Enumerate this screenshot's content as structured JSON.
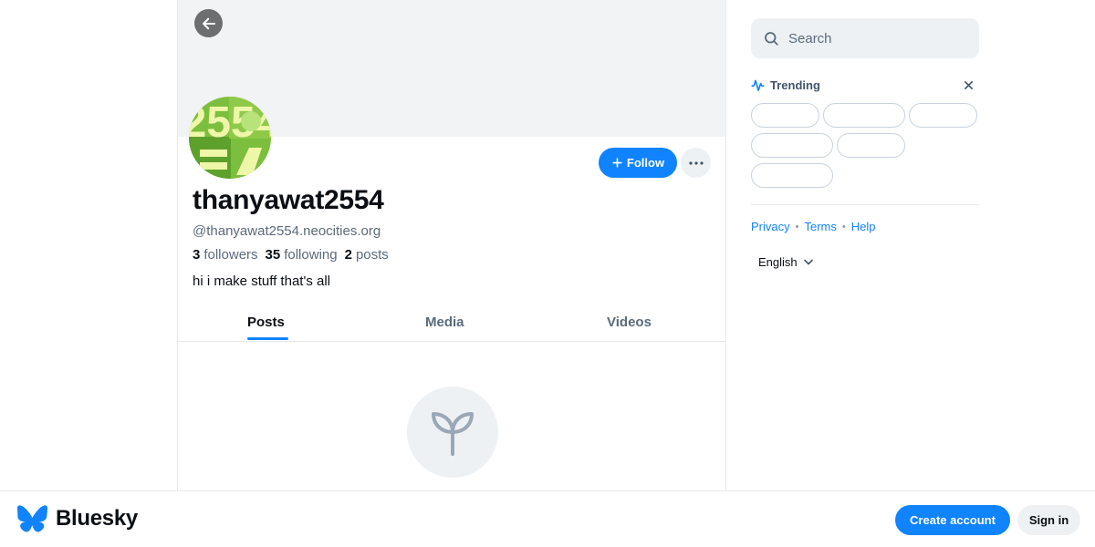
{
  "profile": {
    "display_name": "thanyawat2554",
    "handle": "@thanyawat2554.neocities.org",
    "followers_count": "3",
    "followers_label": "followers",
    "following_count": "35",
    "following_label": "following",
    "posts_count": "2",
    "posts_label": "posts",
    "bio": "hi i make stuff that's all",
    "avatar_text": "2554",
    "follow_label": "Follow"
  },
  "tabs": [
    {
      "label": "Posts",
      "active": true
    },
    {
      "label": "Media",
      "active": false
    },
    {
      "label": "Videos",
      "active": false
    }
  ],
  "sidebar": {
    "search_placeholder": "Search",
    "trending_title": "Trending",
    "links": [
      "Privacy",
      "Terms",
      "Help"
    ],
    "language": "English"
  },
  "bottom_bar": {
    "brand": "Bluesky",
    "create_account": "Create account",
    "sign_in": "Sign in"
  },
  "colors": {
    "accent": "#1083fe",
    "avatar_bg": "#7cbe3e",
    "avatar_fg": "#eef7a8"
  },
  "icons": [
    "arrow-left-icon",
    "plus-icon",
    "ellipsis-icon",
    "sprout-icon",
    "search-icon",
    "trending-icon",
    "close-icon",
    "chevron-down-icon",
    "butterfly-logo-icon"
  ]
}
